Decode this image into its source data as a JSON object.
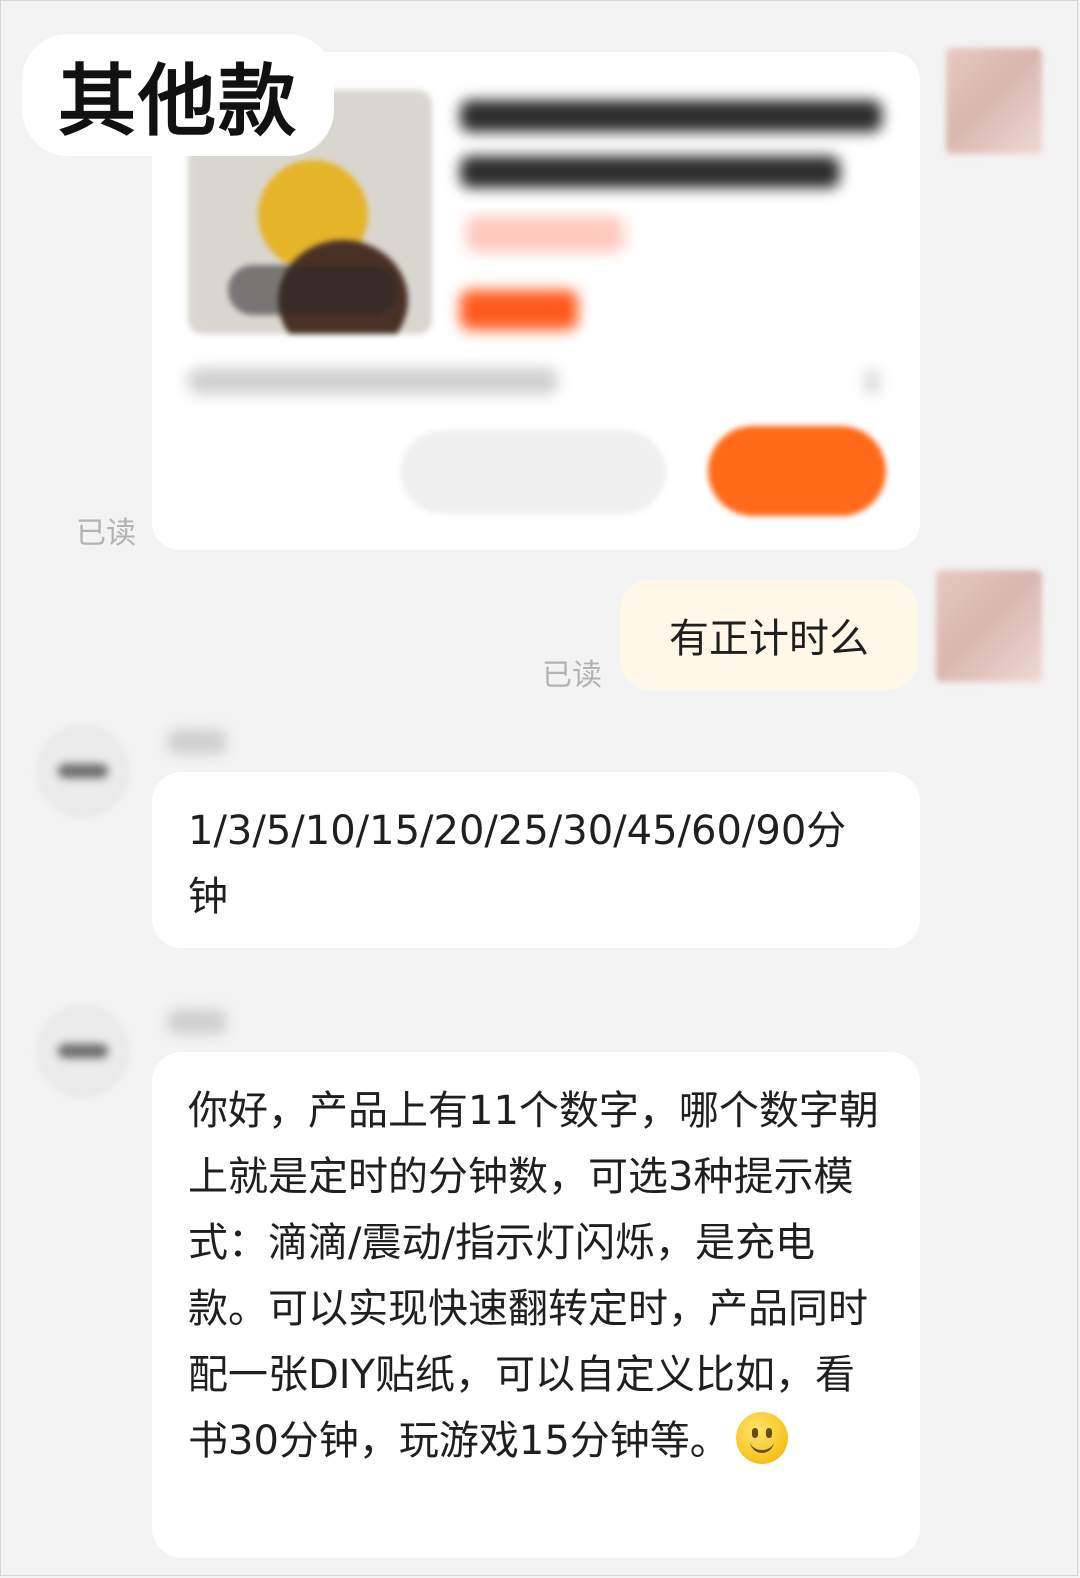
{
  "title_chip": "其他款",
  "product_card": {
    "image": "product-photo-blurred"
  },
  "read_status": "已读",
  "messages": {
    "outgoing_1": "有正计时么",
    "incoming_1": "1/3/5/10/15/20/25/30/45/60/90分钟",
    "incoming_2": "你好，产品上有11个数字，哪个数字朝上就是定时的分钟数，可选3种提示模式：滴滴/震动/指示灯闪烁，是充电款。可以实现快速翻转定时，产品同时配一张DIY贴纸，可以自定义比如，看书30分钟，玩游戏15分钟等。"
  },
  "colors": {
    "background": "#f3f3f3",
    "outgoing_bubble": "#fff7e8",
    "accent_orange": "#ff6a19",
    "read_text": "#b3b3b3"
  },
  "icons": {
    "emoji": "smiling-face-emoji"
  }
}
